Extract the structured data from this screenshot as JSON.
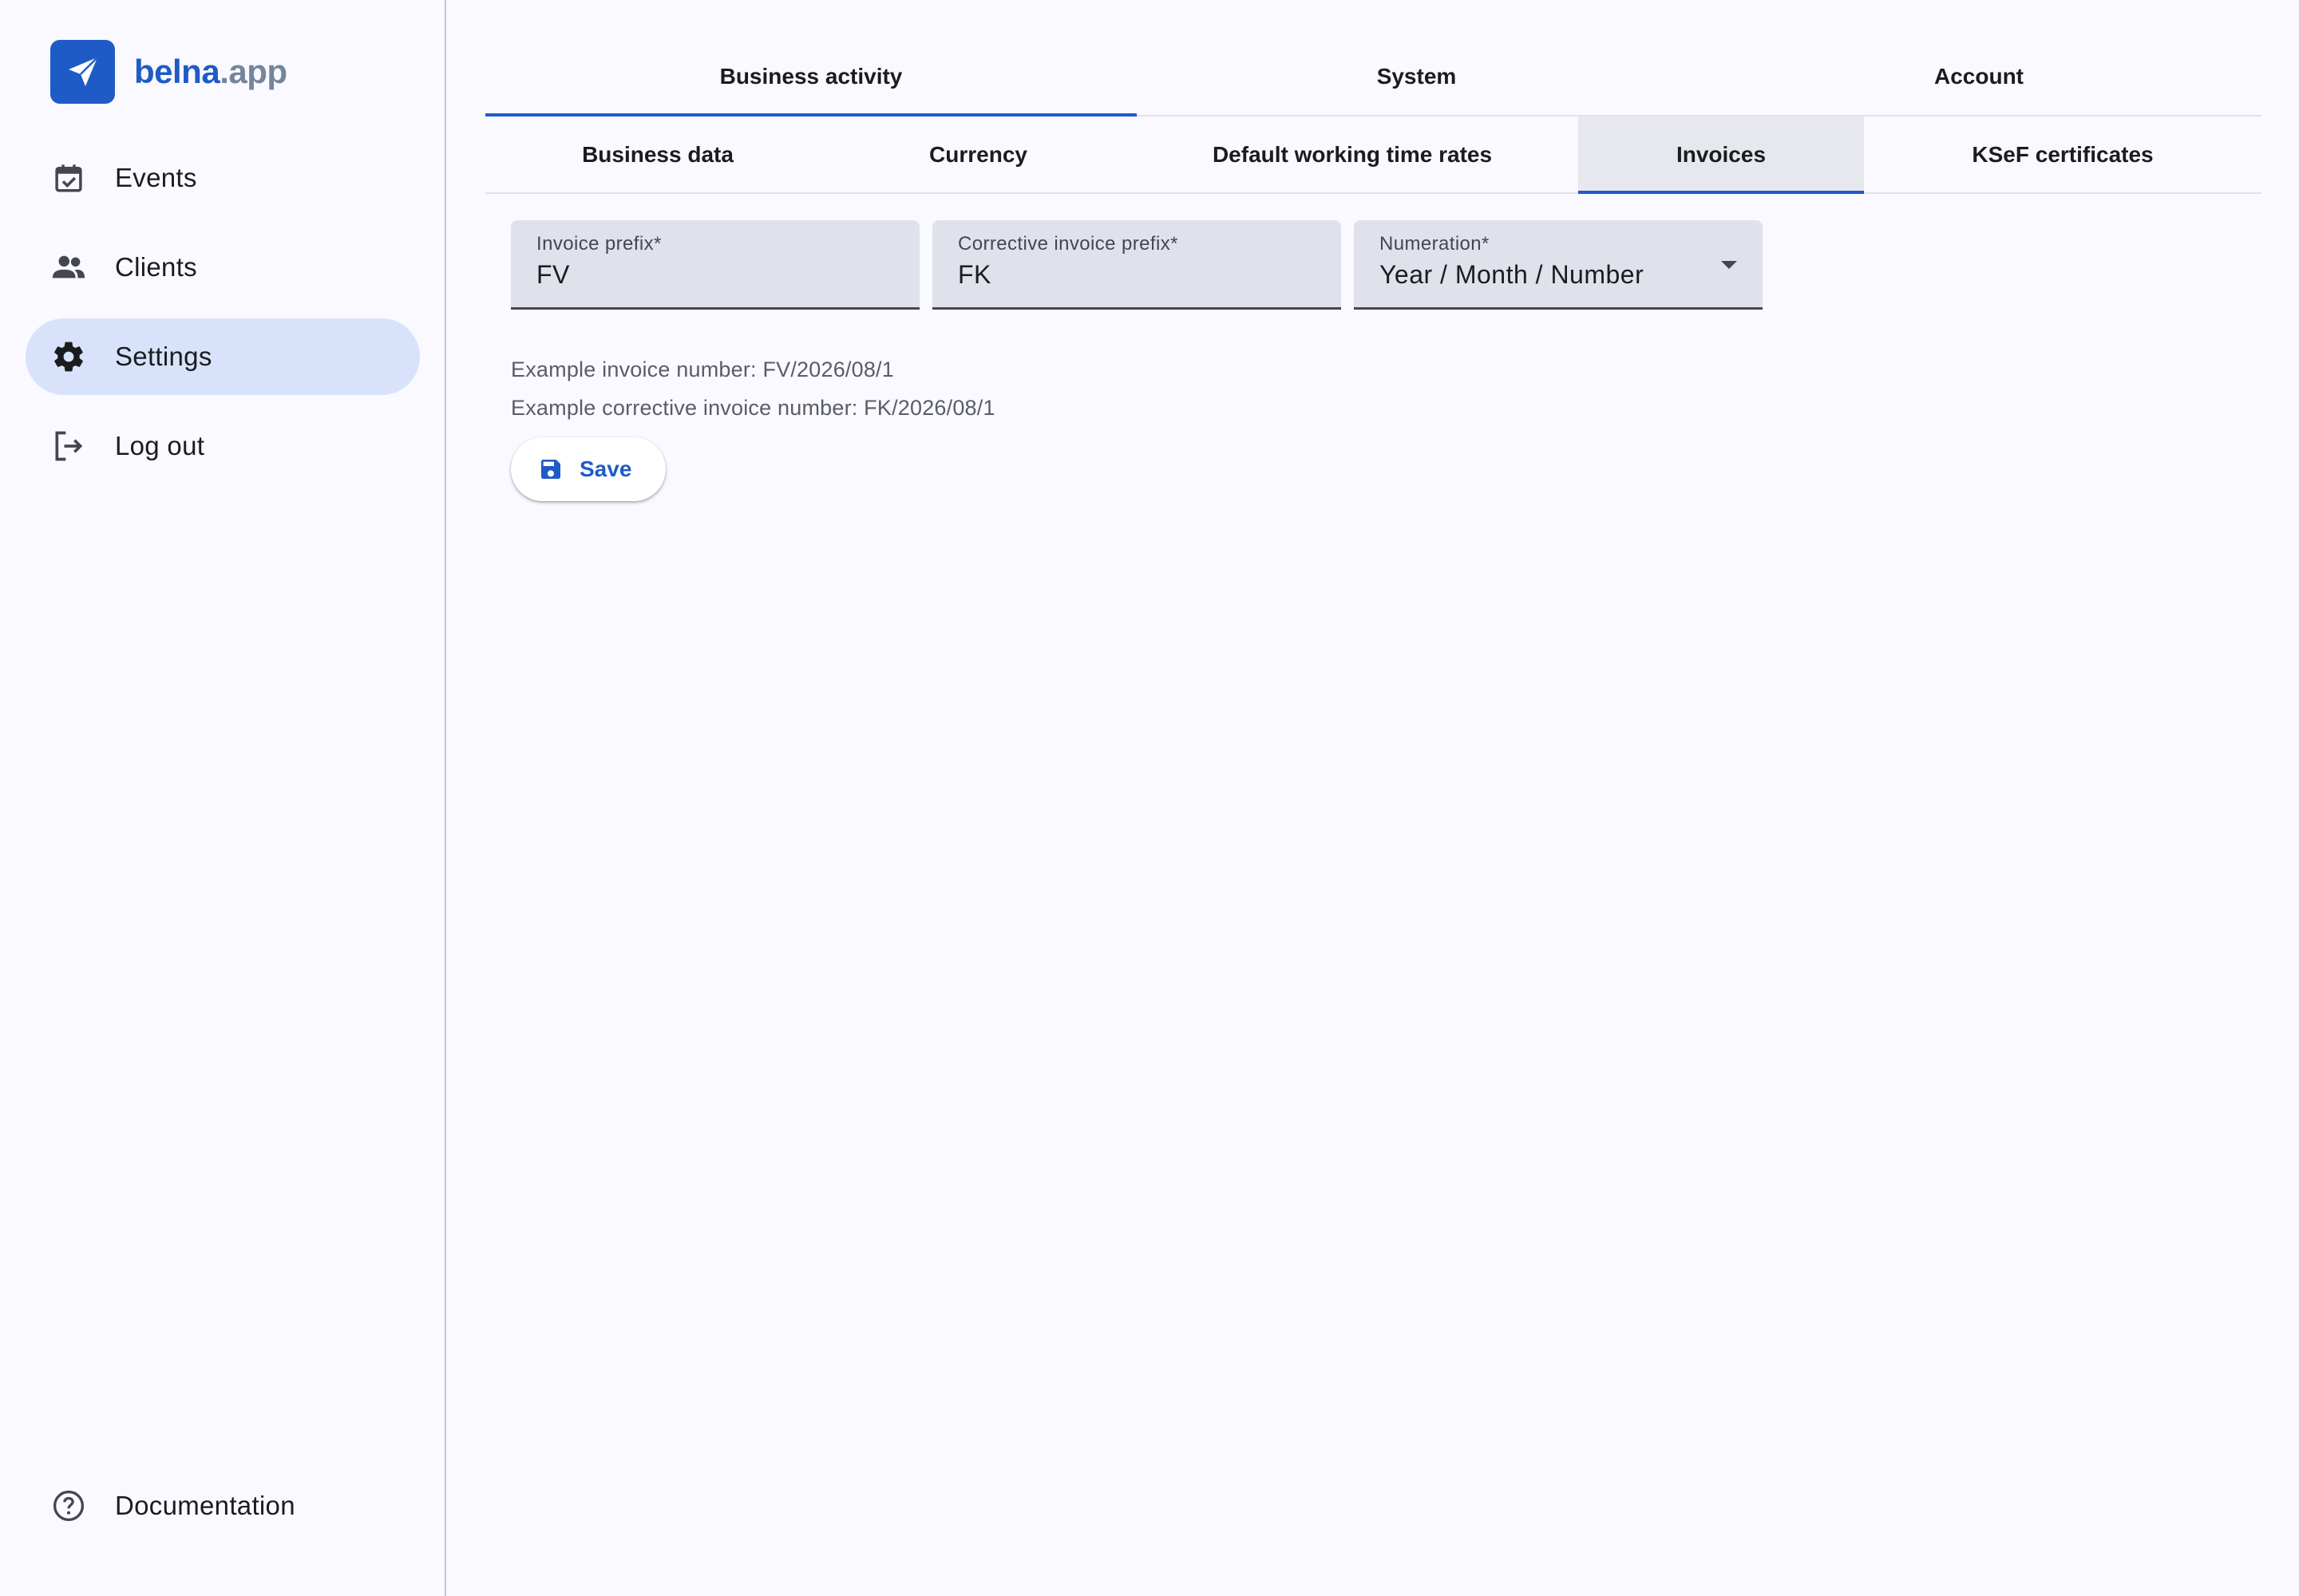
{
  "brand": {
    "name": "belna",
    "tld": ".app",
    "logo_icon": "paper-plane-icon",
    "color": "#1f5bc6"
  },
  "sidebar": {
    "items": [
      {
        "label": "Events",
        "icon": "calendar-check-icon",
        "active": false
      },
      {
        "label": "Clients",
        "icon": "people-icon",
        "active": false
      },
      {
        "label": "Settings",
        "icon": "gear-icon",
        "active": true
      },
      {
        "label": "Log out",
        "icon": "logout-icon",
        "active": false
      }
    ],
    "footer": {
      "label": "Documentation",
      "icon": "help-circle-icon"
    }
  },
  "tabs": {
    "primary": [
      {
        "label": "Business activity",
        "active": true
      },
      {
        "label": "System",
        "active": false
      },
      {
        "label": "Account",
        "active": false
      }
    ],
    "secondary": [
      {
        "label": "Business data",
        "active": false
      },
      {
        "label": "Currency",
        "active": false
      },
      {
        "label": "Default working time rates",
        "active": false
      },
      {
        "label": "Invoices",
        "active": true
      },
      {
        "label": "KSeF certificates",
        "active": false
      }
    ]
  },
  "form": {
    "invoice_prefix": {
      "label": "Invoice prefix*",
      "value": "FV"
    },
    "corrective_prefix": {
      "label": "Corrective invoice prefix*",
      "value": "FK"
    },
    "numeration": {
      "label": "Numeration*",
      "value": "Year / Month / Number"
    },
    "example_invoice": "Example invoice number: FV/2026/08/1",
    "example_corrective": "Example corrective invoice number: FK/2026/08/1",
    "save_label": "Save"
  },
  "colors": {
    "accent": "#1f5bc6",
    "active_nav_bg": "#d8e2fa",
    "field_bg": "#dfe2eb",
    "page_bg": "#f9f9ff"
  }
}
